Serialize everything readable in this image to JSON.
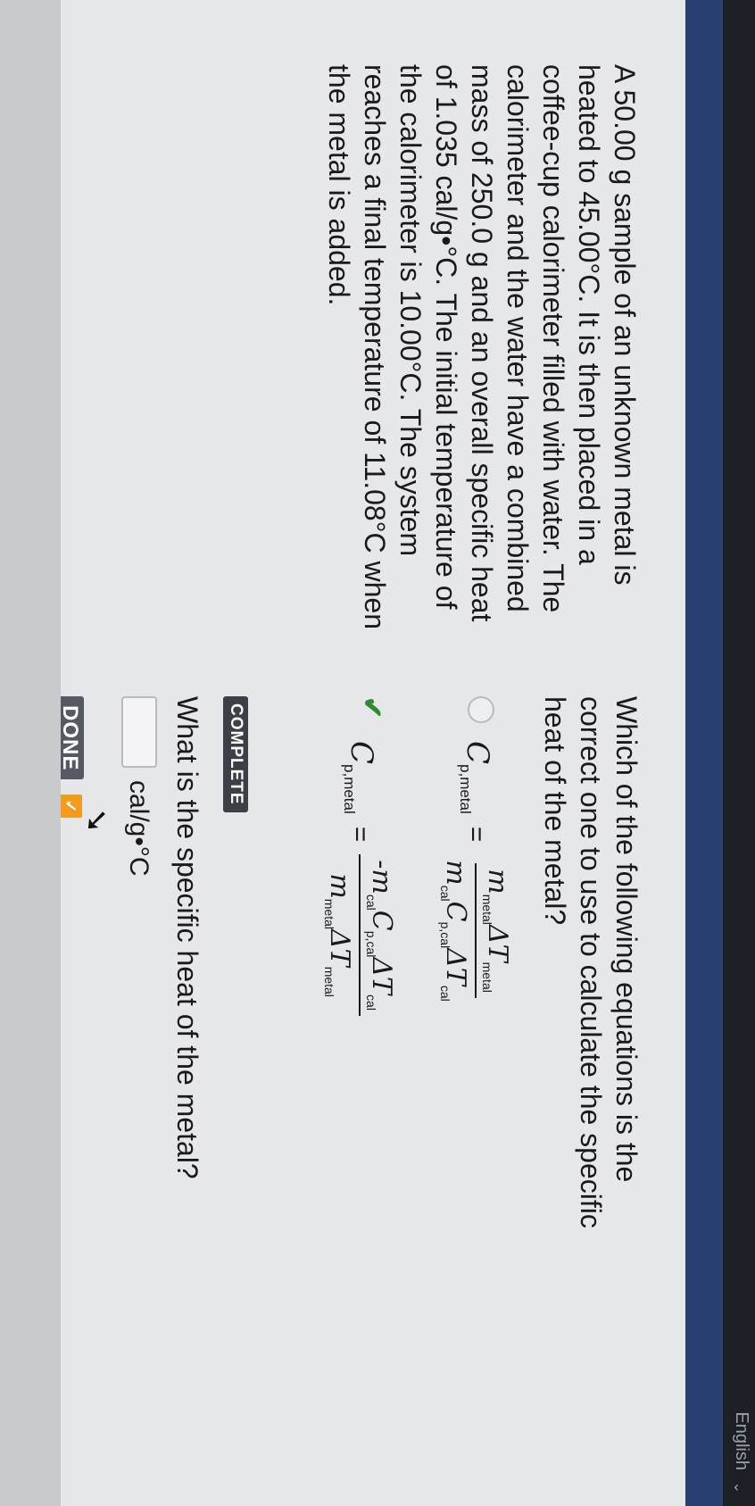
{
  "header": {
    "language": "English",
    "language_chevron": "⌄"
  },
  "problem": {
    "text": "A 50.00 g sample of an unknown metal is heated to 45.00°C. It is then placed in a coffee-cup calorimeter filled with water. The calorimeter and the water have a combined mass of 250.0 g and an overall specific heat of 1.035 cal/g•°C. The initial temperature of the calorimeter is 10.00°C. The system reaches a final temperature of 11.08°C when the metal is added."
  },
  "question_1": {
    "text": "Which of the following equations is the correct one to use to calculate the specific heat of the metal?",
    "options": [
      {
        "lhs": "C",
        "lhs_sub": "p,metal",
        "eq": "=",
        "num": [
          "m",
          "metal",
          "ΔT",
          "metal"
        ],
        "den": [
          "m",
          "cal",
          "C",
          "p,cal",
          "ΔT",
          "cal"
        ],
        "selected": false
      },
      {
        "lhs": "C",
        "lhs_sub": "p,metal",
        "eq": "=",
        "num": [
          "-m",
          "cal",
          "C",
          "p,cal",
          "ΔT",
          "cal"
        ],
        "den": [
          "m",
          "metal",
          "ΔT",
          "metal"
        ],
        "selected": true,
        "check_icon": "✔"
      }
    ],
    "status_badge": "COMPLETE"
  },
  "question_2": {
    "text": "What is the specific heat of the metal?",
    "input_value": "",
    "unit": "cal/g•°C",
    "done_label": "DONE",
    "done_chevron": "✓"
  },
  "icons": {
    "cursor": "➘"
  },
  "colors": {
    "accent": "#f29b1f",
    "check": "#2e8a2e",
    "sidebar": "#27406e"
  }
}
